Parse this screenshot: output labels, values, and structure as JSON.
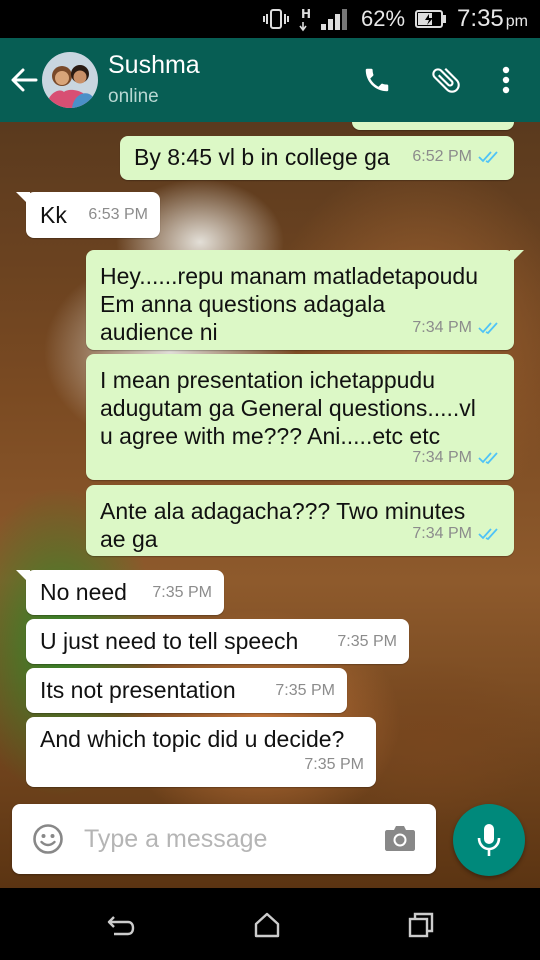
{
  "status_bar": {
    "network_type": "H",
    "battery": "62%",
    "time": "7:35",
    "ampm": "pm"
  },
  "header": {
    "contact_name": "Sushma",
    "contact_status": "online"
  },
  "messages": [
    {
      "direction": "out",
      "text": "By 8:45 vl b in college ga",
      "time": "6:52 PM",
      "read": true
    },
    {
      "direction": "in",
      "text": "Kk",
      "time": "6:53 PM"
    },
    {
      "direction": "out",
      "text": "Hey......repu manam matladetapoudu\nEm anna questions adagala\naudience ni",
      "time": "7:34 PM",
      "read": true
    },
    {
      "direction": "out",
      "text": "I mean presentation ichetappudu\nadugutam ga General questions.....vl\nu agree with me??? Ani.....etc etc",
      "time": "7:34 PM",
      "read": true
    },
    {
      "direction": "out",
      "text": "Ante ala adagacha??? Two minutes\nae ga",
      "time": "7:34 PM",
      "read": true
    },
    {
      "direction": "in",
      "text": "No need",
      "time": "7:35 PM"
    },
    {
      "direction": "in",
      "text": "U just need to tell speech",
      "time": "7:35 PM"
    },
    {
      "direction": "in",
      "text": "Its not presentation",
      "time": "7:35 PM"
    },
    {
      "direction": "in",
      "text": "And which topic did u decide?",
      "time": "7:35 PM"
    }
  ],
  "composer": {
    "placeholder": "Type a message"
  },
  "colors": {
    "header": "#075e54",
    "outgoing_bubble": "#dcf8c6",
    "incoming_bubble": "#ffffff",
    "read_ticks": "#4fc3f7",
    "mic_button": "#00897b"
  }
}
